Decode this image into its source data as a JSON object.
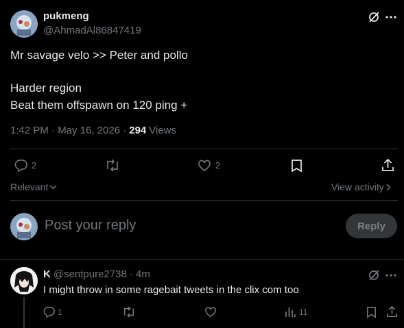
{
  "tweet": {
    "display_name": "pukmeng",
    "handle": "@AhmadAl86847419",
    "line1": "Mr savage velo >> Peter and pollo",
    "line2": "Harder region",
    "line3": "Beat them offspawn on 120 ping +",
    "timestamp": "1:42 PM · May 16, 2026 ·",
    "views_count": "294",
    "views_label": "Views",
    "replies": "2",
    "likes": "2"
  },
  "sort": {
    "relevant": "Relevant",
    "view_activity": "View activity"
  },
  "compose": {
    "placeholder": "Post your reply",
    "reply_button": "Reply"
  },
  "reply": {
    "display_name": "K",
    "handle": "@sentpure2738",
    "time": "· 4m",
    "text": "I might throw in some ragebait tweets in the clix com too",
    "replies": "1",
    "views": "11"
  },
  "colors": {
    "background": "#000000",
    "text": "#e7e9ea",
    "muted": "#71767b",
    "divider": "#2f3336",
    "reply_button_bg": "#333639"
  },
  "icons": [
    "grok-icon",
    "more-icon",
    "reply-icon",
    "retweet-icon",
    "like-icon",
    "bookmark-icon",
    "share-icon",
    "chevron-down-icon",
    "chevron-right-icon",
    "views-icon"
  ]
}
